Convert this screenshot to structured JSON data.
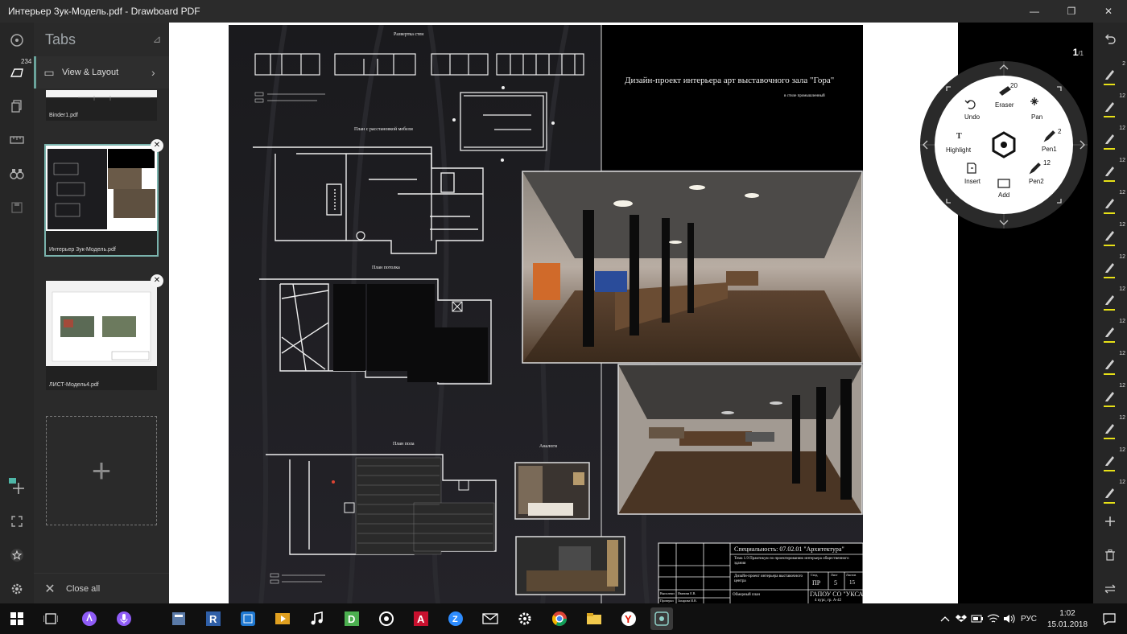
{
  "window": {
    "title": "Интерьер 3ук-Модель.pdf - Drawboard PDF",
    "minimize": "—",
    "restore": "❐",
    "close": "✕"
  },
  "left_rail": {
    "badge": "234",
    "icons": [
      "drawboard-logo-icon",
      "layout-icon",
      "pages-icon",
      "ruler-icon",
      "binoculars-icon",
      "save-icon",
      "add-spark-icon",
      "fullscreen-icon",
      "favorite-icon",
      "settings-icon"
    ]
  },
  "tabs_panel": {
    "title": "Tabs",
    "pin": "⊿",
    "view_layout": "View & Layout",
    "tabs": [
      {
        "name": "Binder1.pdf"
      },
      {
        "name": "Интерьер 3ук-Модель.pdf"
      },
      {
        "name": "ЛИСТ-Модель4.pdf"
      }
    ],
    "add": "+",
    "close_all": "Close all"
  },
  "sheet": {
    "title": "Дизайн-проект интерьера арт выставочного  зала  \"Гора\"",
    "subtitle": "в стиле промышленный",
    "razvertka": "Развертка стен",
    "plan_mebel": "План с расстановкой мебели",
    "plan_potolka": "План потолка",
    "plan_pola": "План пола",
    "analogi": "Аналоги",
    "stamp": {
      "specialty": "Специальность: 07.02.01 \"Архитектура\"",
      "theme": "Тема 1.9 Практикум по проектированию интерьера общественного здания",
      "project": "Дизайн-проект интерьера выставочного центра",
      "stage_label": "Стад.",
      "sheet_label": "Лист",
      "sheets_label": "Листов",
      "stage": "ПР",
      "sheet": "5",
      "sheets": "15",
      "drawing": "Обмерный план",
      "org": "ГАПОУ СО \"УКСАП\"",
      "group": "4 курс, гр. А-42",
      "dev": "Выполнил",
      "dev_name": "Иванова Е.В.",
      "check": "Проверил",
      "check_name": "Захарова И.В."
    }
  },
  "viewer": {
    "page_current": "1",
    "page_total": "/1"
  },
  "radial_menu": {
    "center": "hexagon-icon",
    "items": [
      {
        "label": "Eraser",
        "count": "20"
      },
      {
        "label": "Pan",
        "count": ""
      },
      {
        "label": "Pen1",
        "count": "2"
      },
      {
        "label": "Pen2",
        "count": "12"
      },
      {
        "label": "Add",
        "count": ""
      },
      {
        "label": "Insert",
        "count": ""
      },
      {
        "label": "Highlight",
        "count": ""
      },
      {
        "label": "Undo",
        "count": ""
      }
    ]
  },
  "right_rail": {
    "pen_counts": [
      "2",
      "12",
      "12",
      "12",
      "12",
      "12",
      "12",
      "12",
      "12",
      "12",
      "12",
      "12",
      "12",
      "12"
    ]
  },
  "taskbar": {
    "language": "РУС",
    "time": "1:02",
    "date": "15.01.2018"
  },
  "colors": {
    "accent": "#7ab3ad",
    "pen_yellow": "#e6e017",
    "panel": "#2a2a2a",
    "rail": "#262626"
  }
}
